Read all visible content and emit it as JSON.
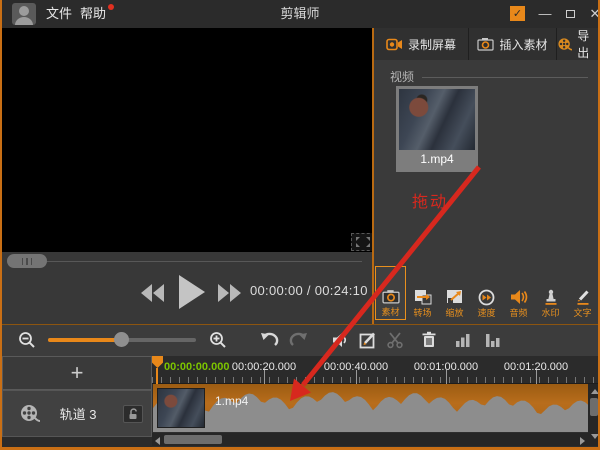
{
  "titlebar": {
    "menu_file": "文件",
    "menu_help": "帮助",
    "title": "剪辑师"
  },
  "preview": {
    "time_display": "00:00:00 / 00:24:10"
  },
  "right_panel": {
    "record_screen_label": "录制屏幕",
    "insert_material_label": "插入素材",
    "export_label": "导出",
    "section_label": "视频",
    "clip_name": "1.mp4",
    "drag_hint": "拖动",
    "tabs": [
      {
        "label": "素材",
        "selected": true
      },
      {
        "label": "转场",
        "selected": false
      },
      {
        "label": "缩放",
        "selected": false
      },
      {
        "label": "速度",
        "selected": false
      },
      {
        "label": "音频",
        "selected": false
      },
      {
        "label": "水印",
        "selected": false
      },
      {
        "label": "文字",
        "selected": false
      }
    ]
  },
  "timeline": {
    "add_track_label": "+",
    "track_name": "轨道 3",
    "current_time": "00:00:00.000",
    "ruler_marks": [
      "00:00:20.000",
      "00:00:40.000",
      "00:01:00.000",
      "00:01:20.000"
    ],
    "clip_name": "1.mp4"
  },
  "colors": {
    "accent_orange": "#e8881a",
    "clip_orange": "#b06818",
    "time_green": "#7cc400",
    "drag_red": "#d7281e"
  }
}
